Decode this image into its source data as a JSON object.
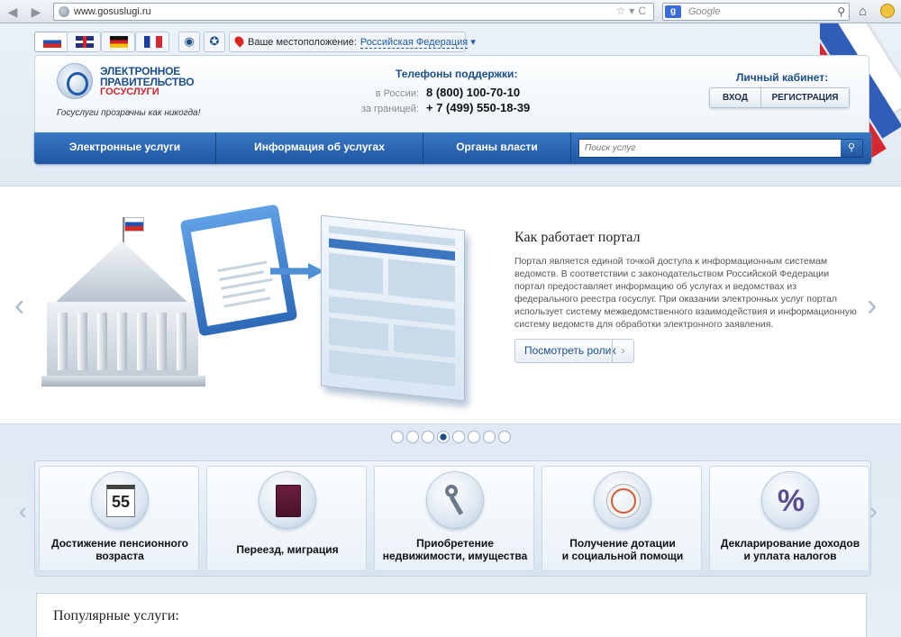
{
  "browser": {
    "url": "www.gosuslugi.ru",
    "search_engine_label": "g",
    "search_placeholder": "Google"
  },
  "topbar": {
    "languages": [
      "ru",
      "en",
      "de",
      "fr"
    ],
    "location_label": "Ваше местоположение:",
    "location_value": "Российская Федерация"
  },
  "header": {
    "logo_line1": "ЭЛЕКТРОННОЕ",
    "logo_line2": "ПРАВИТЕЛЬСТВО",
    "logo_line3": "ГОСУСЛУГИ",
    "slogan": "Госуслуги прозрачны как никогда!",
    "phones_title": "Телефоны поддержки:",
    "phone_ru_label": "в России:",
    "phone_ru": "8 (800) 100-70-10",
    "phone_abroad_label": "за границей:",
    "phone_abroad": "+ 7 (499) 550-18-39",
    "cabinet_title": "Личный кабинет:",
    "login": "ВХОД",
    "register": "РЕГИСТРАЦИЯ"
  },
  "nav": {
    "items": [
      "Электронные услуги",
      "Информация об услугах",
      "Органы власти"
    ],
    "search_placeholder": "Поиск услуг"
  },
  "slider": {
    "title": "Как работает портал",
    "text": "Портал является единой точкой доступа к информационным системам ведомств. В соответствии с законодательством Российской Федерации портал предоставляет информацию об услугах и ведомствах из федерального реестра госуслуг. При оказании электронных услуг портал использует систему межведомственного взаимодействия и информационную систему ведомств для обработки электронного заявления.",
    "button": "Посмотреть ролик",
    "dots_total": 8,
    "dot_active": 4
  },
  "categories": [
    {
      "l1": "Достижение пенсионного",
      "l2": "возраста",
      "icon": "calendar-icon",
      "icon_text": "55"
    },
    {
      "l1": "Переезд, миграция",
      "l2": "",
      "icon": "passport-icon"
    },
    {
      "l1": "Приобретение",
      "l2": "недвижимости, имущества",
      "icon": "keys-icon"
    },
    {
      "l1": "Получение дотации",
      "l2": "и социальной помощи",
      "icon": "lifebuoy-icon"
    },
    {
      "l1": "Декларирование доходов",
      "l2": "и уплата налогов",
      "icon": "percent-icon",
      "icon_text": "%"
    }
  ],
  "popular": {
    "title": "Популярные услуги:"
  }
}
